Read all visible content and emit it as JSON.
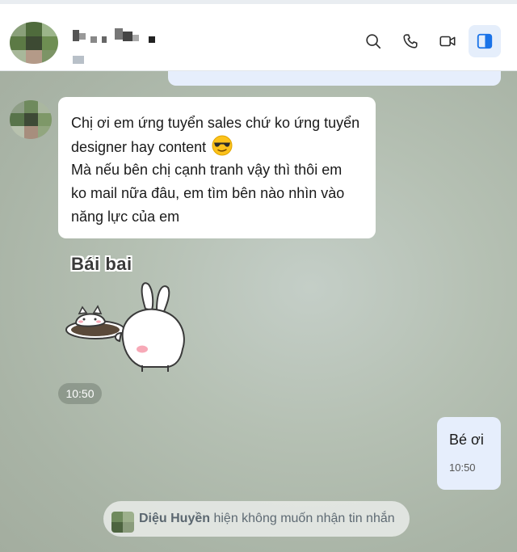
{
  "header": {
    "actions": [
      {
        "name": "search-button",
        "icon": "search-icon"
      },
      {
        "name": "call-button",
        "icon": "phone-icon"
      },
      {
        "name": "video-call-button",
        "icon": "video-icon"
      },
      {
        "name": "toggle-panel-button",
        "icon": "sidebar-panel-icon",
        "active": true
      }
    ],
    "accent_color": "#1a73e8"
  },
  "messages": {
    "incoming": {
      "lines": [
        "Chị ơi em ứng tuyển sales chứ ko ứng tuyển",
        "designer hay content",
        "Mà nếu bên chị cạnh tranh vậy thì thôi em",
        "ko mail nữa đâu, em tìm bên nào nhìn vào",
        "năng lực của em"
      ],
      "emoji": "sunglasses-emoji"
    },
    "sticker": {
      "text": "Bái bai"
    },
    "sticker_time": "10:50",
    "outgoing": {
      "text": "Bé ơi",
      "time": "10:50"
    }
  },
  "notice": {
    "name": "Diệu Huyền",
    "text": " hiện không muốn nhận tin nhắn"
  }
}
